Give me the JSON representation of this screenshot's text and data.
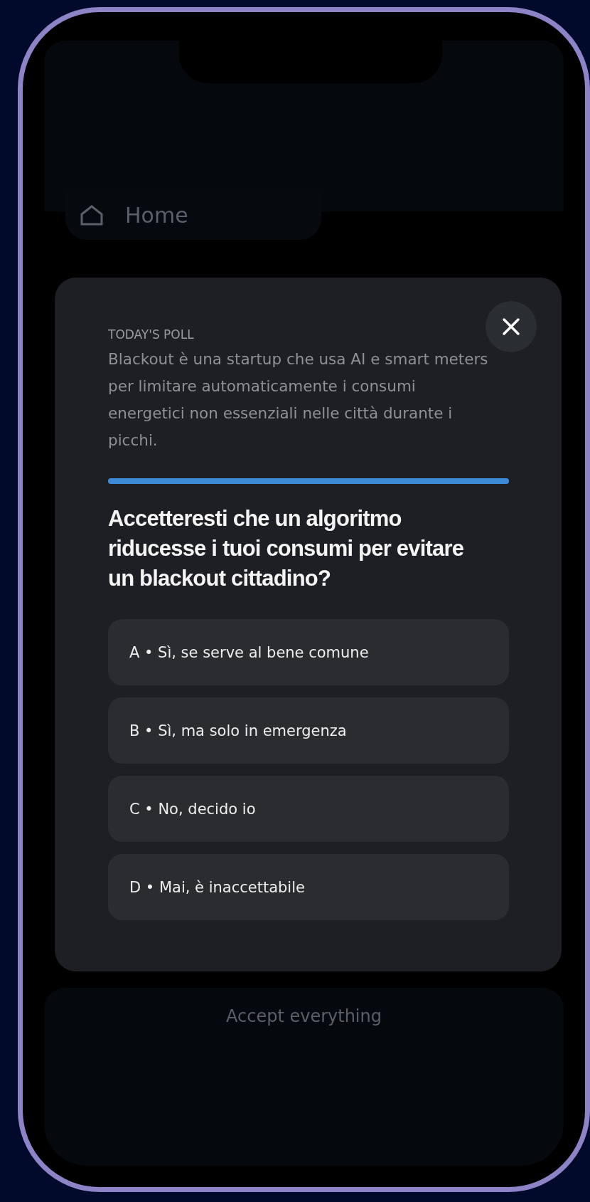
{
  "background": {
    "nav_items": [
      {
        "label": "Home"
      }
    ],
    "footer_button": "Accept everything"
  },
  "poll": {
    "eyebrow": "TODAY'S POLL",
    "description": "Blackout è una startup che usa AI e smart meters per limitare automaticamente i consumi energetici non essenziali nelle città durante i picchi.",
    "progress": {
      "level": 1
    },
    "question": "Accetteresti che un algoritmo riducesse i tuoi consumi per evitare un blackout cittadino?",
    "options": [
      {
        "label": "A • Sì, se serve al bene comune",
        "selected": false
      },
      {
        "label": "B • Sì, ma solo in emergenza",
        "selected": false
      },
      {
        "label": "C • No, decido io",
        "selected": false
      },
      {
        "label": "D • Mai, è inaccettabile",
        "selected": false
      }
    ]
  }
}
